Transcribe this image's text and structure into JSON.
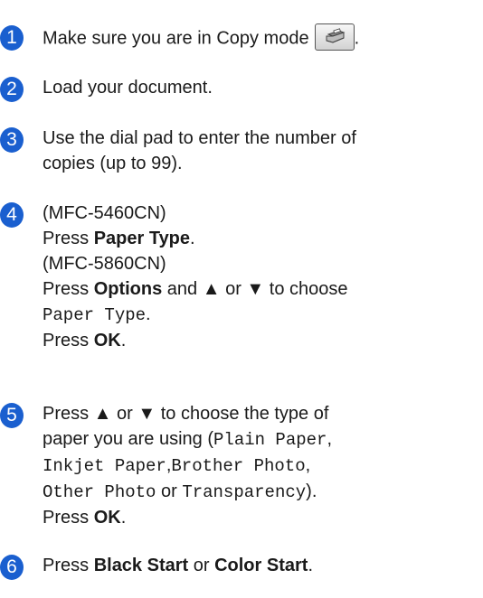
{
  "steps": [
    {
      "number": "1",
      "lines": [
        {
          "t1": "Make sure you are in Copy mode",
          "t2": "."
        }
      ],
      "icon": "copy-mode-icon"
    },
    {
      "number": "2",
      "lines": [
        {
          "t1": "Load your document."
        }
      ]
    },
    {
      "number": "3",
      "lines": [
        {
          "t1": "Use the dial pad to enter the number of"
        },
        {
          "t1": "copies (up to 99)."
        }
      ]
    },
    {
      "number": "4",
      "lines": [
        {
          "t1": "(MFC-5460CN)"
        },
        {
          "t1": "Press ",
          "b1": "Paper Type",
          "t2": "."
        },
        {
          "t1": "(MFC-5860CN)"
        },
        {
          "t1": "Press ",
          "b1": "Options",
          "t2": " and ▲ or ▼ to choose"
        },
        {
          "m1": "Paper Type",
          "t1": "."
        },
        {
          "t1": "Press ",
          "b1": "OK",
          "t2": "."
        }
      ]
    },
    {
      "number": "5",
      "lines": [
        {
          "t1": "Press ▲ or ▼ to choose the type of"
        },
        {
          "t1": "paper you are using (",
          "m1": "Plain Paper",
          "t2": ","
        },
        {
          "m1": "Inkjet Paper",
          "t1": ",",
          "m2": "Brother Photo",
          "t2": ","
        },
        {
          "m1": "Other Photo",
          "t1": " or ",
          "m2": "Transparency",
          "t2": ")."
        },
        {
          "t1": "Press ",
          "b1": "OK",
          "t2": "."
        }
      ]
    },
    {
      "number": "6",
      "lines": [
        {
          "t1": "Press ",
          "b1": "Black Start",
          "t2": " or ",
          "b2": "Color Start",
          "t3": "."
        }
      ]
    }
  ],
  "colors": {
    "badge": "#1a5fcf",
    "text": "#1a1a1a"
  }
}
